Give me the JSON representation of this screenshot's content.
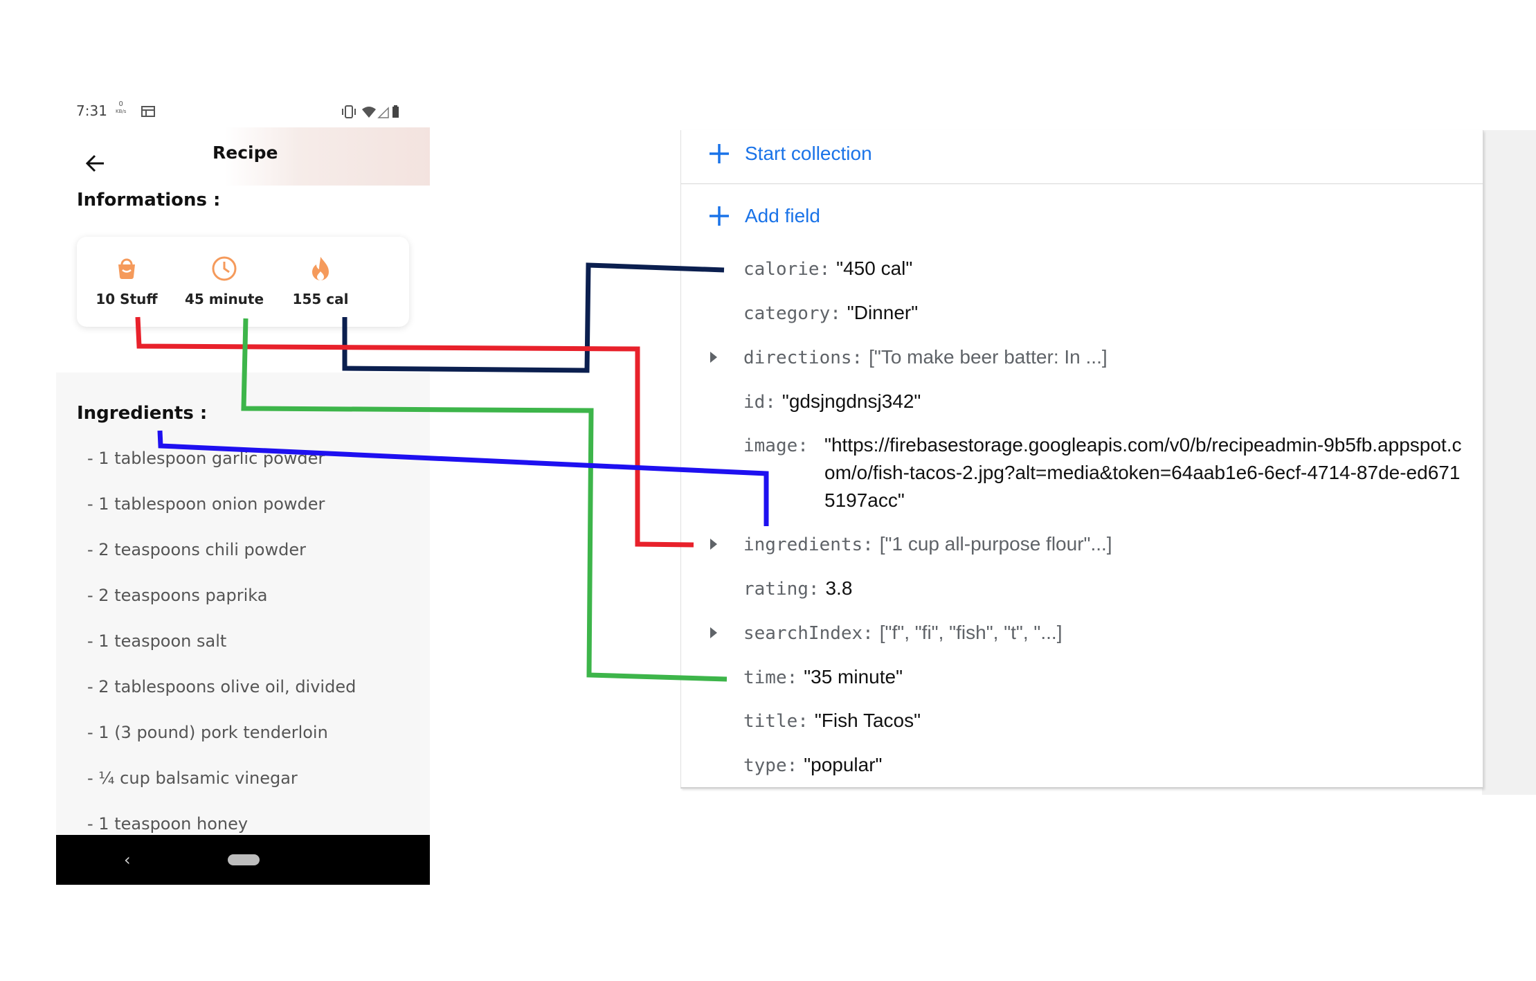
{
  "status_bar": {
    "time": "7:31",
    "speed_value": "0",
    "speed_unit": "KB/s",
    "icons": [
      "notification-icon",
      "vibrate-icon",
      "wifi-icon",
      "signal-icon",
      "battery-icon"
    ]
  },
  "header": {
    "title": "Recipe",
    "back_icon": "arrow-left-icon"
  },
  "informations": {
    "title": "Informations :",
    "stats": [
      {
        "icon": "basket-icon",
        "label": "10 Stuff"
      },
      {
        "icon": "clock-icon",
        "label": "45 minute"
      },
      {
        "icon": "flame-icon",
        "label": "155 cal"
      }
    ]
  },
  "ingredients": {
    "title": "Ingredients :",
    "items": [
      "- 1 tablespoon garlic powder",
      "- 1 tablespoon onion powder",
      "- 2 teaspoons chili powder",
      "- 2 teaspoons paprika",
      "- 1 teaspoon salt",
      "- 2 tablespoons olive oil, divided",
      "- 1 (3 pound) pork tenderloin",
      "- ¼ cup balsamic vinegar",
      "- 1 teaspoon honey"
    ]
  },
  "firestore": {
    "start_collection": "Start collection",
    "add_field": "Add field",
    "fields": {
      "calorie": {
        "key": "calorie:",
        "value": "\"450 cal\""
      },
      "category": {
        "key": "category:",
        "value": "\"Dinner\""
      },
      "directions": {
        "key": "directions:",
        "value": "[\"To make beer batter: In ...]"
      },
      "id": {
        "key": "id:",
        "value": "\"gdsjngdnsj342\""
      },
      "image": {
        "key": "image:",
        "value": "\"https://firebasestorage.googleapis.com/v0/b/recipeadmin-9b5fb.appspot.com/o/fish-tacos-2.jpg?alt=media&token=64aab1e6-6ecf-4714-87de-ed6715197acc\""
      },
      "ingredients": {
        "key": "ingredients:",
        "value": "[\"1 cup all-purpose flour\"...]"
      },
      "rating": {
        "key": "rating:",
        "value": "3.8"
      },
      "searchIndex": {
        "key": "searchIndex:",
        "value": "[\"f\", \"fi\", \"fish\", \"t\", \"...]"
      },
      "time": {
        "key": "time:",
        "value": "\"35 minute\""
      },
      "title": {
        "key": "title:",
        "value": "\"Fish Tacos\""
      },
      "type": {
        "key": "type:",
        "value": "\"popular\""
      }
    }
  },
  "colors": {
    "accent_orange": "#F59A5B",
    "firestore_blue": "#1A73E8",
    "connector_red": "#E8212B",
    "connector_green": "#3DB54A",
    "connector_navy": "#0B1F4F",
    "connector_blue": "#1E10F0"
  }
}
